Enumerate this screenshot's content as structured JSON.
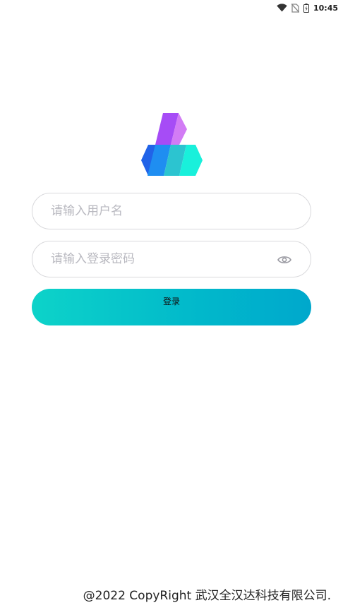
{
  "status_bar": {
    "time": "10:45",
    "icons": [
      "wifi-icon",
      "no-sim-icon",
      "battery-charging-icon"
    ]
  },
  "logo": {
    "icon": "brand-logo"
  },
  "login_form": {
    "username": {
      "placeholder": "请输入用户名",
      "value": ""
    },
    "password": {
      "placeholder": "请输入登录密码",
      "value": "",
      "toggle_icon": "eye-icon"
    },
    "submit_label": "登录"
  },
  "footer": {
    "copyright": "@2022 CopyRight 武汉全汉达科技有限公司."
  },
  "colors": {
    "button_gradient_start": "#0dd3c9",
    "button_gradient_end": "#00a8cc",
    "field_border": "#d9d9dc",
    "placeholder": "#b9b9c0"
  }
}
